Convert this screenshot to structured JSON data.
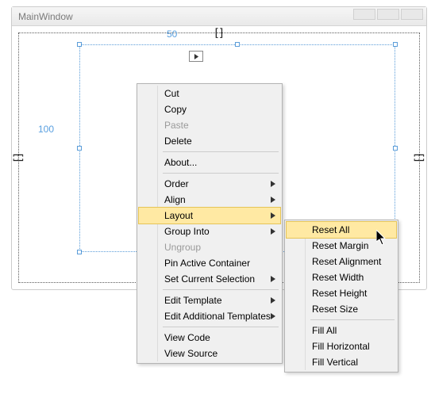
{
  "window": {
    "title": "MainWindow"
  },
  "dimensions": {
    "top": "50",
    "left": "100"
  },
  "contextMenu": {
    "items": [
      {
        "label": "Cut",
        "type": "item"
      },
      {
        "label": "Copy",
        "type": "item"
      },
      {
        "label": "Paste",
        "type": "item",
        "disabled": true
      },
      {
        "label": "Delete",
        "type": "item"
      },
      {
        "type": "sep"
      },
      {
        "label": "About...",
        "type": "item"
      },
      {
        "type": "sep"
      },
      {
        "label": "Order",
        "type": "submenu"
      },
      {
        "label": "Align",
        "type": "submenu"
      },
      {
        "label": "Layout",
        "type": "submenu",
        "hover": true
      },
      {
        "label": "Group Into",
        "type": "submenu"
      },
      {
        "label": "Ungroup",
        "type": "item",
        "disabled": true
      },
      {
        "label": "Pin Active Container",
        "type": "item"
      },
      {
        "label": "Set Current Selection",
        "type": "submenu"
      },
      {
        "type": "sep"
      },
      {
        "label": "Edit Template",
        "type": "submenu"
      },
      {
        "label": "Edit Additional Templates",
        "type": "submenu"
      },
      {
        "type": "sep"
      },
      {
        "label": "View Code",
        "type": "item"
      },
      {
        "label": "View Source",
        "type": "item"
      }
    ],
    "subMenu": {
      "items": [
        {
          "label": "Reset All",
          "hover": true
        },
        {
          "label": "Reset Margin"
        },
        {
          "label": "Reset Alignment"
        },
        {
          "label": "Reset Width"
        },
        {
          "label": "Reset Height"
        },
        {
          "label": "Reset Size"
        },
        {
          "type": "sep"
        },
        {
          "label": "Fill All"
        },
        {
          "label": "Fill Horizontal"
        },
        {
          "label": "Fill Vertical"
        }
      ]
    }
  }
}
